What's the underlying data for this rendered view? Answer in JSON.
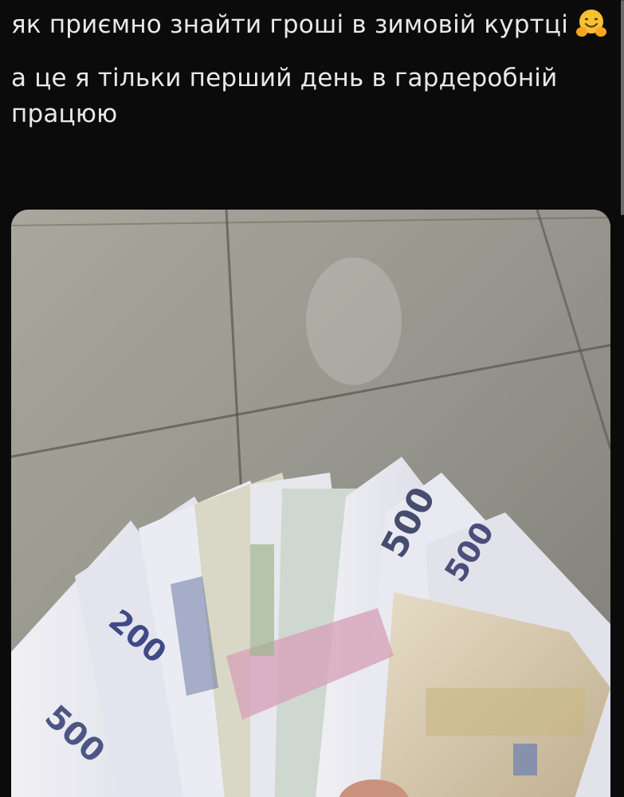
{
  "tweet": {
    "line1_text": "як приємно знайти гроші в зимовій куртці",
    "emoji": "hugging-face-emoji",
    "line2_text": "а це я тільки перший день в гардеробній працюю"
  },
  "media": {
    "description_icon": "photo",
    "banknote_labels": {
      "front_500": "500",
      "second_200": "200",
      "top_500": "500",
      "right_500": "500"
    }
  },
  "colors": {
    "background": "#0b0b0b",
    "text": "#e9e9e9",
    "tile": "#8d8c83"
  }
}
